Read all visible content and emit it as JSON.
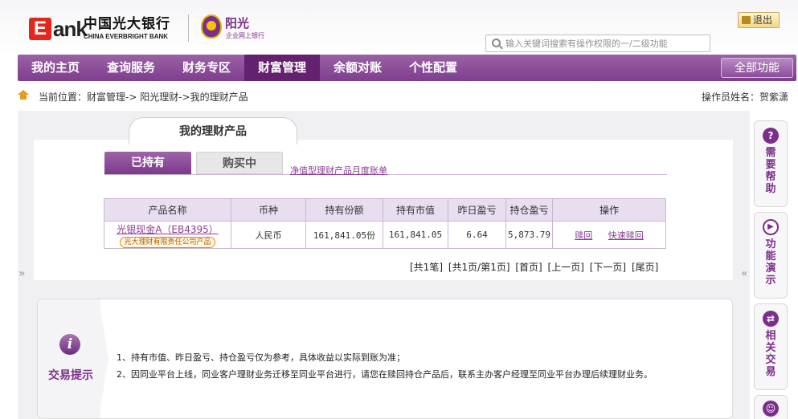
{
  "header": {
    "logo_e": "E",
    "logo_ank": "ank",
    "logo_cn": "中国光大银行",
    "logo_en": "CHINA EVERBRIGHT BANK",
    "sub_brand": "阳光",
    "sub_brand_tagline": "企业网上银行",
    "logout_label": "退出",
    "search_placeholder": "输入关键词搜索有操作权限的一/二级功能"
  },
  "nav": {
    "items": [
      {
        "label": "我的主页"
      },
      {
        "label": "查询服务"
      },
      {
        "label": "财务专区"
      },
      {
        "label": "财富管理"
      },
      {
        "label": "余额对账"
      },
      {
        "label": "个性配置"
      }
    ],
    "active_index": 3,
    "all_functions_label": "全部功能"
  },
  "breadcrumb": {
    "text": "当前位置：财富管理->  阳光理财->我的理财产品",
    "operator": "操作员姓名：贺紫潇"
  },
  "content": {
    "main_tab": "我的理财产品",
    "sub_tabs": [
      {
        "label": "已持有"
      },
      {
        "label": "购买中"
      }
    ],
    "bill_link": "净值型理财产品月度账单",
    "table": {
      "headers": [
        "产品名称",
        "币种",
        "持有份额",
        "持有市值",
        "昨日盈亏",
        "持仓盈亏",
        "操作"
      ],
      "rows": [
        {
          "product_name": "光银现金A（EB4395）",
          "issuer": "光大理财有限责任公司产品",
          "currency": "人民币",
          "shares": "161,841.05份",
          "market_value": "161,841.05",
          "yesterday_pnl": "6.64",
          "position_pnl": "5,873.79",
          "ops": [
            "赎回",
            "快速赎回"
          ]
        }
      ]
    },
    "pager": [
      "[共1笔]",
      "[共1页/第1页]",
      "[首页]",
      "[上一页]",
      "[下一页]",
      "[尾页]"
    ]
  },
  "tips": {
    "title": "交易提示",
    "icon_letter": "i",
    "lines": [
      "1、持有市值、昨日盈亏、持仓盈亏仅为参考，具体收益以实际到账为准；",
      "2、因同业平台上线，同业客户理财业务迁移至同业平台进行，请您在赎回持仓产品后，联系主办客户经理至同业平台办理后续理财业务。"
    ]
  },
  "help_bar": [
    {
      "label": "需要帮助",
      "icon": "question-icon"
    },
    {
      "label": "功能演示",
      "icon": "play-icon"
    },
    {
      "label": "相关交易",
      "icon": "swap-icon"
    }
  ],
  "side_arrows": {
    "left": "»",
    "right": "«"
  },
  "colors": {
    "brand_purple": "#7b2e8a",
    "nav_active": "#64216f",
    "logo_red": "#e3281b"
  }
}
